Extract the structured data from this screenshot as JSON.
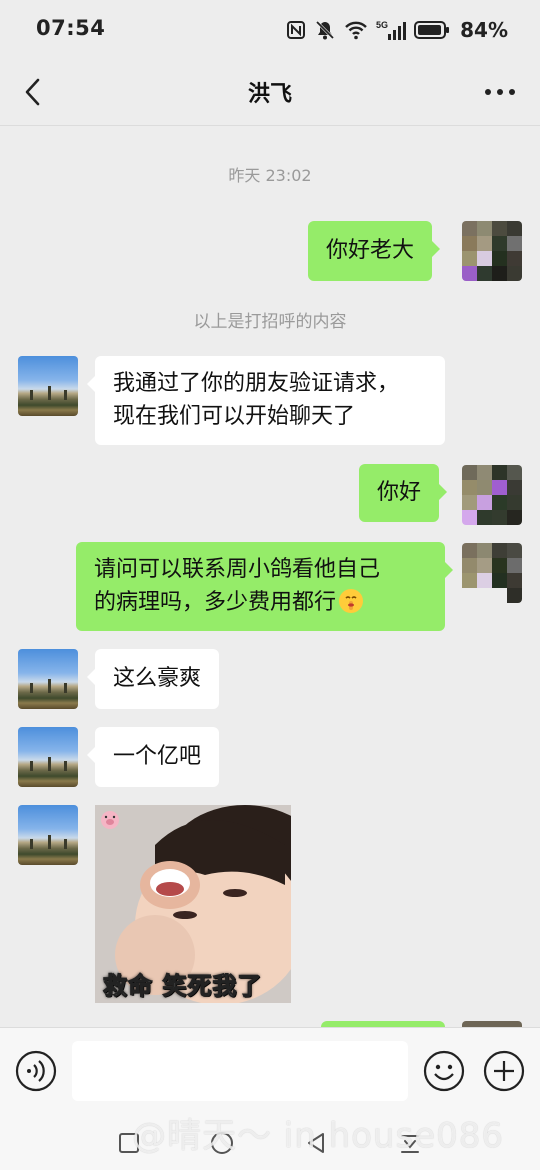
{
  "status_bar": {
    "time": "07:54",
    "battery": "84%",
    "icons": [
      "nfc-icon",
      "mute-icon",
      "wifi-icon",
      "5g-signal-icon",
      "battery-icon"
    ]
  },
  "header": {
    "title": "洪飞",
    "back_icon": "chevron-left-icon",
    "more_icon": "ellipsis-icon"
  },
  "chat": {
    "timestamp": "昨天 23:02",
    "system_note": "以上是打招呼的内容",
    "messages": [
      {
        "side": "right",
        "text": "你好老大"
      },
      {
        "side": "left",
        "line1": "我通过了你的朋友验证请求，",
        "line2": "现在我们可以开始聊天了"
      },
      {
        "side": "right",
        "text": "你好"
      },
      {
        "side": "right",
        "line1": "请问可以联系周小鸽看他自己",
        "line2": "的病理吗，多少费用都行",
        "emoji": "shushing-face-emoji"
      },
      {
        "side": "left",
        "text": "这么豪爽"
      },
      {
        "side": "left",
        "text": "一个亿吧"
      },
      {
        "side": "left",
        "type": "sticker",
        "caption": "救命 笑死我了"
      }
    ]
  },
  "input_bar": {
    "voice_icon": "voice-icon",
    "emoji_icon": "smiley-icon",
    "plus_icon": "plus-circle-icon"
  },
  "nav_bar": {
    "icons": [
      "square-recent-icon",
      "circle-home-icon",
      "triangle-back-icon",
      "down-arrow-icon"
    ],
    "watermark": "@晴天～ in house086"
  },
  "colors": {
    "chat_background": "#ededed",
    "sent_bubble": "#95ec69",
    "received_bubble": "#ffffff",
    "meta_text": "#9a9a9a"
  }
}
